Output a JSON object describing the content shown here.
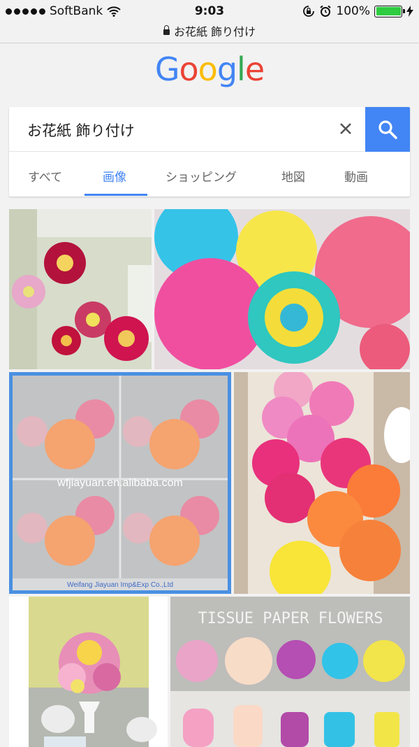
{
  "status_bar": {
    "carrier": "SoftBank",
    "time": "9:03",
    "battery": "100%",
    "icons": [
      "signal-dots-icon",
      "wifi-icon",
      "rotation-lock-icon",
      "alarm-icon",
      "battery-icon",
      "charging-bolt-icon"
    ]
  },
  "address_bar": {
    "url": "お花紙 飾り付け",
    "icon": "lock-icon"
  },
  "logo": {
    "letters": [
      "G",
      "o",
      "o",
      "g",
      "l",
      "e"
    ],
    "colors": [
      "#4285f4",
      "#ea4335",
      "#fbbc05",
      "#4285f4",
      "#34a853",
      "#ea4335"
    ]
  },
  "search": {
    "query": "お花紙 飾り付け",
    "clear_icon": "close-icon",
    "button_icon": "search-icon",
    "accent_color": "#4285f4"
  },
  "tabs": [
    {
      "label": "すべて",
      "active": false
    },
    {
      "label": "画像",
      "active": true
    },
    {
      "label": "ショッピング",
      "active": false
    },
    {
      "label": "地図",
      "active": false
    },
    {
      "label": "動画",
      "active": false
    }
  ],
  "results": {
    "watermarks": {
      "tile3_main": "wfjiayuan.en.alibaba.com",
      "tile3_footer": "Weifang Jiayuan Imp&Exp Co.,Ltd",
      "tile6_title": "TISSUE PAPER FLOWERS"
    }
  }
}
